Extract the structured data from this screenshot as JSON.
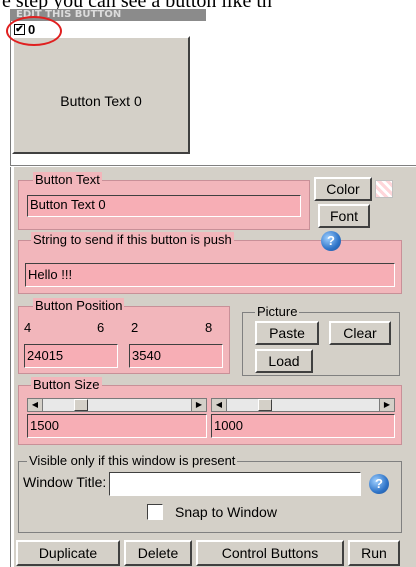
{
  "page_header_fragment": "e step you can see a button like th",
  "title_bar": "EDIT THIS BUTTON",
  "preview": {
    "checkbox_checked": "✔",
    "index": "0",
    "button_text": "Button Text 0"
  },
  "button_text_group": {
    "legend": "Button Text",
    "value": "Button Text 0",
    "color_label": "Color",
    "font_label": "Font"
  },
  "string_group": {
    "legend": "String to send if this button is push",
    "value": "Hello !!!",
    "help_icon": "?"
  },
  "position_group": {
    "legend": "Button Position",
    "x_min": "4",
    "x_max": "6",
    "y_min": "2",
    "y_max": "8",
    "x_value": "24015",
    "y_value": "3540"
  },
  "picture_group": {
    "legend": "Picture",
    "paste_label": "Paste",
    "clear_label": "Clear",
    "load_label": "Load"
  },
  "size_group": {
    "legend": "Button Size",
    "width_value": "1500",
    "height_value": "1000"
  },
  "visibility_group": {
    "legend": "Visible only if this window is present",
    "window_title_label": "Window Title:",
    "window_title_value": "",
    "snap_label": "Snap to Window",
    "help_icon": "?"
  },
  "bottom_buttons": {
    "duplicate": "Duplicate",
    "delete": "Delete",
    "control": "Control Buttons",
    "run": "Run"
  },
  "colors": {
    "highlight_pink": "#f2b6bb",
    "window_gray": "#d4d0c8",
    "annotation_red": "#e02020"
  }
}
